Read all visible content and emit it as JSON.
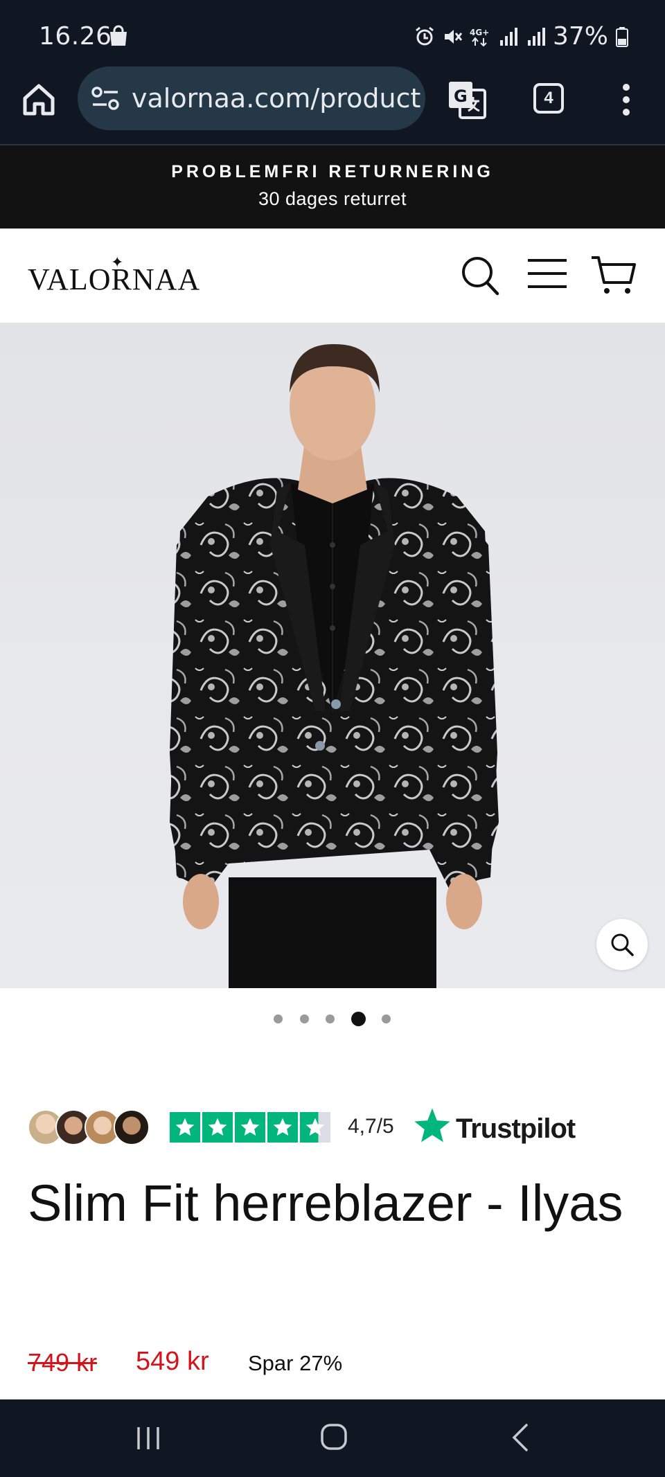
{
  "status_bar": {
    "time": "16.26",
    "battery": "37%",
    "network": "4G+"
  },
  "browser": {
    "url": "valornaa.com/product",
    "tab_count": "4"
  },
  "announcement": {
    "title": "PROBLEMFRI RETURNERING",
    "subtitle": "30 dages returret"
  },
  "header": {
    "logo": "VALORNAA"
  },
  "gallery": {
    "dot_count": 5,
    "active_index": 3
  },
  "rating": {
    "score_text": "4,7/5",
    "score": 4.7,
    "brand": "Trustpilot",
    "brand_color": "#00b67a"
  },
  "product": {
    "title": "Slim Fit herreblazer - Ilyas",
    "price_old": "749 kr",
    "price_new": "549 kr",
    "savings": "Spar 27%"
  },
  "colors": {
    "system_bar": "#111722",
    "url_pill": "#243847",
    "sale_red": "#d4141b",
    "announcement_bg": "#121212"
  }
}
